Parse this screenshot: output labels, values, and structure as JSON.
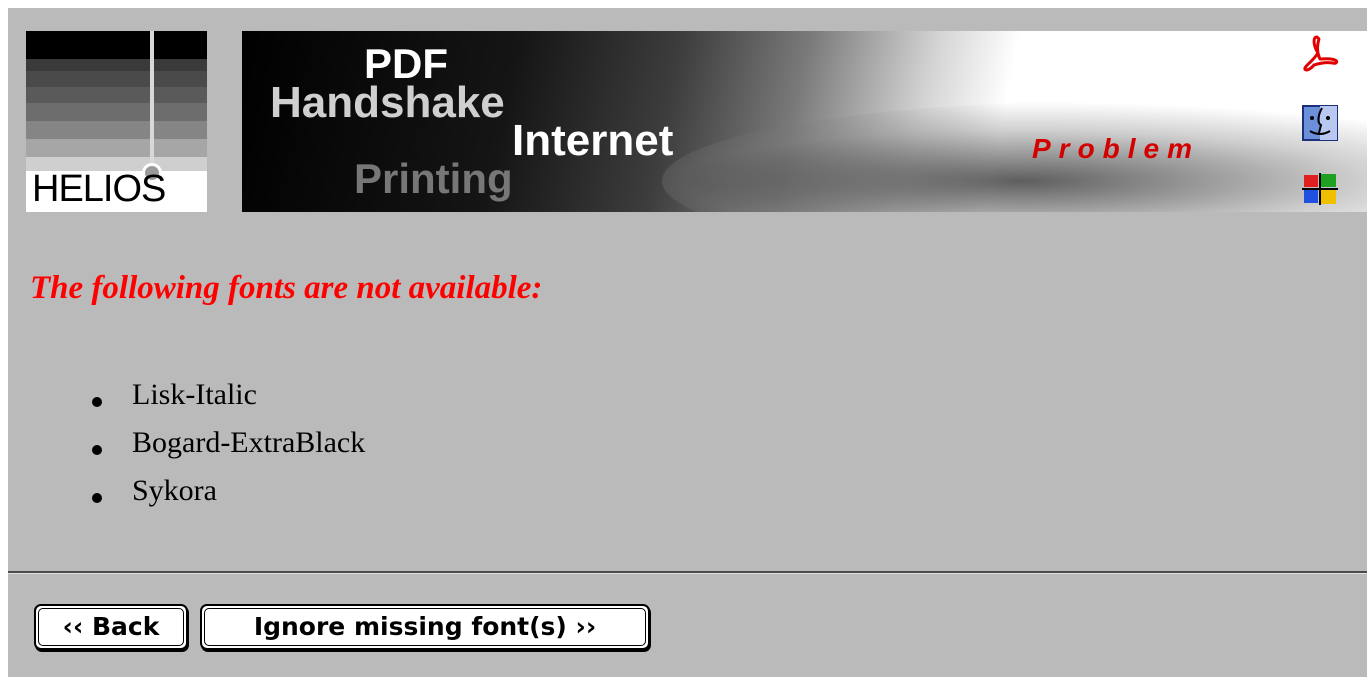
{
  "logo": {
    "text": "HELIOS"
  },
  "banner": {
    "line1": "PDF",
    "line2": "Handshake",
    "line3": "Internet",
    "line4": "Printing",
    "tag": "Problem",
    "icons": [
      "acrobat-icon",
      "mac-finder-icon",
      "windows-icon"
    ]
  },
  "message": {
    "heading": "The following fonts are not available:",
    "fonts": [
      "Lisk-Italic",
      "Bogard-ExtraBlack",
      "Sykora"
    ]
  },
  "buttons": {
    "back": "‹‹ Back",
    "ignore": "Ignore missing font(s) ››"
  },
  "colors": {
    "background": "#bababa",
    "heading": "#ff0000",
    "problem": "#d40000"
  }
}
